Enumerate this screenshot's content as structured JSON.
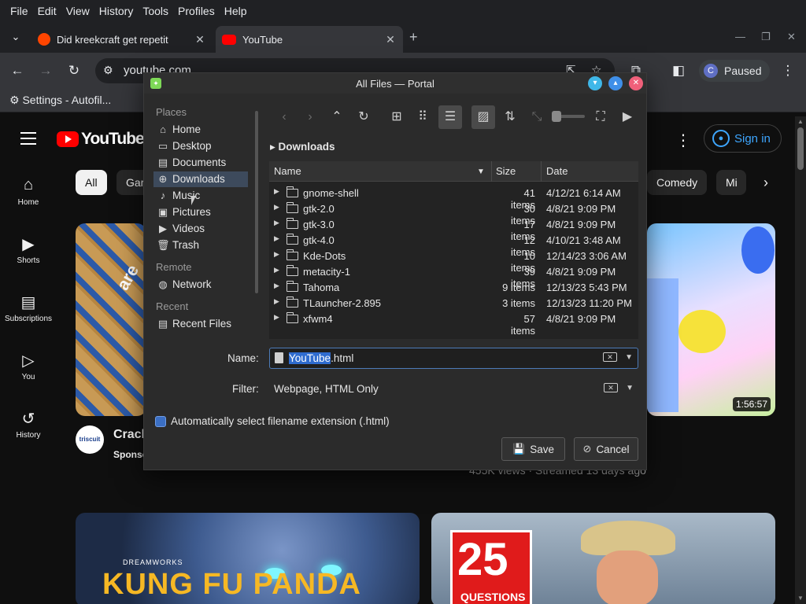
{
  "browser": {
    "menu": [
      "File",
      "Edit",
      "View",
      "History",
      "Tools",
      "Profiles",
      "Help"
    ],
    "tabs": [
      {
        "title": "Did kreekcraft get repetit",
        "favicon_color": "#ff4500"
      },
      {
        "title": "YouTube",
        "favicon_color": "#ff0000"
      }
    ],
    "url": "youtube.com",
    "profile_status": "Paused",
    "profile_initial": "C",
    "bookmark": "Settings - Autofil..."
  },
  "youtube": {
    "logo_text": "YouTube",
    "sign_in": "Sign in",
    "rail": [
      "Home",
      "Shorts",
      "Subscriptions",
      "You",
      "History"
    ],
    "chips": [
      "All",
      "Gar",
      "Comedy",
      "Mi"
    ],
    "duration": "1:56:57",
    "card1_title": "Crack",
    "card1_sub": "Sponso",
    "card1_channel": "triscuit",
    "card1_thumb_word": "are",
    "card2_meta": "455K views · Streamed 13 days ago",
    "card3_brand": "DREAMWORKS",
    "card3_title": "KUNG FU PANDA",
    "card4_number": "25",
    "card4_caption": "QUESTIONS"
  },
  "dialog": {
    "title": "All Files — Portal",
    "places_label": "Places",
    "places": [
      "Home",
      "Desktop",
      "Documents",
      "Downloads",
      "Music",
      "Pictures",
      "Videos",
      "Trash"
    ],
    "remote_label": "Remote",
    "remote": [
      "Network"
    ],
    "recent_label": "Recent",
    "recent": [
      "Recent Files"
    ],
    "breadcrumb": "Downloads",
    "columns": {
      "name": "Name",
      "size": "Size",
      "date": "Date"
    },
    "files": [
      {
        "name": "gnome-shell",
        "size": "41 items",
        "date": "4/12/21 6:14 AM"
      },
      {
        "name": "gtk-2.0",
        "size": "30 items",
        "date": "4/8/21 9:09 PM"
      },
      {
        "name": "gtk-3.0",
        "size": "17 items",
        "date": "4/8/21 9:09 PM"
      },
      {
        "name": "gtk-4.0",
        "size": "12 items",
        "date": "4/10/21 3:48 AM"
      },
      {
        "name": "Kde-Dots",
        "size": "10 items",
        "date": "12/14/23 3:06 AM"
      },
      {
        "name": "metacity-1",
        "size": "39 items",
        "date": "4/8/21 9:09 PM"
      },
      {
        "name": "Tahoma",
        "size": "9 items",
        "date": "12/13/23 5:43 PM"
      },
      {
        "name": "TLauncher-2.895",
        "size": "3 items",
        "date": "12/13/23 11:20 PM"
      },
      {
        "name": "xfwm4",
        "size": "57 items",
        "date": "4/8/21 9:09 PM"
      }
    ],
    "name_label": "Name:",
    "name_selected": "YouTube",
    "name_rest": ".html",
    "filter_label": "Filter:",
    "filter_value": "Webpage, HTML Only",
    "auto_ext_label": "Automatically select filename extension (.html)",
    "save": "Save",
    "cancel": "Cancel"
  }
}
